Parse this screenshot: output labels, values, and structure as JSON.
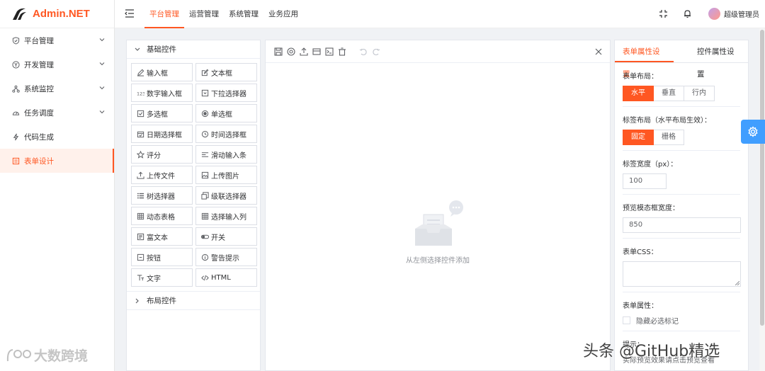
{
  "app": {
    "name": "Admin.NET",
    "brand_color": "#ff5722"
  },
  "sidebar": {
    "items": [
      {
        "label": "平台管理",
        "icon": "shield-icon",
        "arrow": true
      },
      {
        "label": "开发管理",
        "icon": "circle-yen-icon",
        "arrow": true
      },
      {
        "label": "系统监控",
        "icon": "cluster-icon",
        "arrow": true
      },
      {
        "label": "任务调度",
        "icon": "gauge-icon",
        "arrow": true
      },
      {
        "label": "代码生成",
        "icon": "lightning-icon",
        "arrow": false
      },
      {
        "label": "表单设计",
        "icon": "form-icon",
        "arrow": false,
        "active": true
      }
    ]
  },
  "header": {
    "tabs": [
      "平台管理",
      "运营管理",
      "系统管理",
      "业务应用"
    ],
    "active_tab": 0,
    "user_name": "超级管理员"
  },
  "widgets": {
    "basic_group_label": "基础控件",
    "layout_group_label": "布局控件",
    "items": [
      {
        "label": "输入框",
        "icon": "edit-icon"
      },
      {
        "label": "文本框",
        "icon": "edit-box-icon"
      },
      {
        "label": "数字输入框",
        "icon": "number-icon"
      },
      {
        "label": "下拉选择器",
        "icon": "dropdown-icon"
      },
      {
        "label": "多选框",
        "icon": "checkbox-icon"
      },
      {
        "label": "单选框",
        "icon": "radio-icon"
      },
      {
        "label": "日期选择框",
        "icon": "calendar-icon"
      },
      {
        "label": "时间选择框",
        "icon": "clock-icon"
      },
      {
        "label": "评分",
        "icon": "star-icon"
      },
      {
        "label": "滑动输入条",
        "icon": "slider-icon"
      },
      {
        "label": "上传文件",
        "icon": "upload-icon"
      },
      {
        "label": "上传图片",
        "icon": "image-icon"
      },
      {
        "label": "树选择器",
        "icon": "tree-icon"
      },
      {
        "label": "级联选择器",
        "icon": "cascader-icon"
      },
      {
        "label": "动态表格",
        "icon": "table-icon"
      },
      {
        "label": "选择输入列",
        "icon": "table-icon"
      },
      {
        "label": "富文本",
        "icon": "richtext-icon"
      },
      {
        "label": "开关",
        "icon": "switch-icon"
      },
      {
        "label": "按钮",
        "icon": "button-icon"
      },
      {
        "label": "警告提示",
        "icon": "info-icon"
      },
      {
        "label": "文字",
        "icon": "text-icon"
      },
      {
        "label": "HTML",
        "icon": "code-icon"
      }
    ]
  },
  "canvas": {
    "empty_text": "从左侧选择控件添加"
  },
  "props": {
    "tabs": [
      "表单属性设置",
      "控件属性设置"
    ],
    "active_tab": 0,
    "form_layout_label": "表单布局：",
    "form_layout_options": [
      "水平",
      "垂直",
      "行内"
    ],
    "form_layout_selected": "水平",
    "label_layout_label": "标签布局（水平布局生效）：",
    "label_layout_options": [
      "固定",
      "栅格"
    ],
    "label_layout_selected": "固定",
    "label_width_label": "标签宽度（px）：",
    "label_width_value": "100",
    "preview_width_label": "预览模态框宽度：",
    "preview_width_value": "850",
    "form_css_label": "表单CSS：",
    "form_attr_label": "表单属性：",
    "hide_required_label": "隐藏必选标记",
    "hint_label": "提示：",
    "hint_text": "实际预览效果请点击预览查看"
  },
  "watermarks": {
    "left": "大数跨境",
    "right": "头条 @GitHub精选"
  }
}
